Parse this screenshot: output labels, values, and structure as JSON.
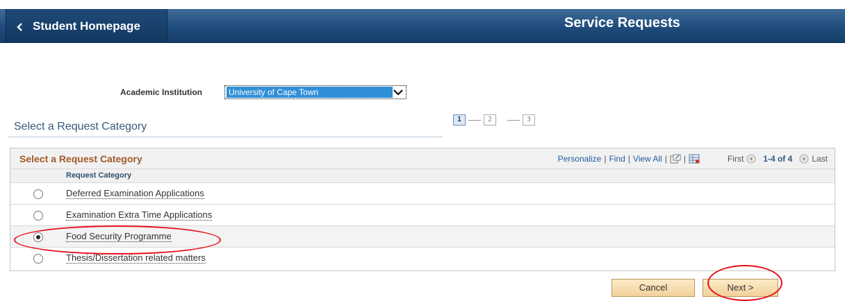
{
  "header": {
    "back_label": "Student Homepage",
    "page_title": "Service Requests"
  },
  "institution": {
    "label": "Academic Institution",
    "selected": "University of Cape Town"
  },
  "section": {
    "title": "Select a Request Category",
    "steps": [
      "1",
      "2",
      "3"
    ],
    "active_step": 1
  },
  "grid": {
    "title": "Select a Request Category",
    "tools": {
      "personalize": "Personalize",
      "find": "Find",
      "view_all": "View All",
      "first": "First",
      "range": "1-4 of 4",
      "last": "Last"
    },
    "column_header": "Request Category",
    "rows": [
      {
        "label": "Deferred Examination Applications",
        "selected": false
      },
      {
        "label": "Examination Extra Time Applications",
        "selected": false
      },
      {
        "label": "Food Security Programme",
        "selected": true
      },
      {
        "label": "Thesis/Dissertation related matters",
        "selected": false
      }
    ]
  },
  "buttons": {
    "cancel": "Cancel",
    "next": "Next >"
  },
  "colors": {
    "header_bg": "#1f4c7c",
    "grid_title": "#a05a28",
    "link": "#1f5c9e",
    "annotation": "#e8101c"
  }
}
